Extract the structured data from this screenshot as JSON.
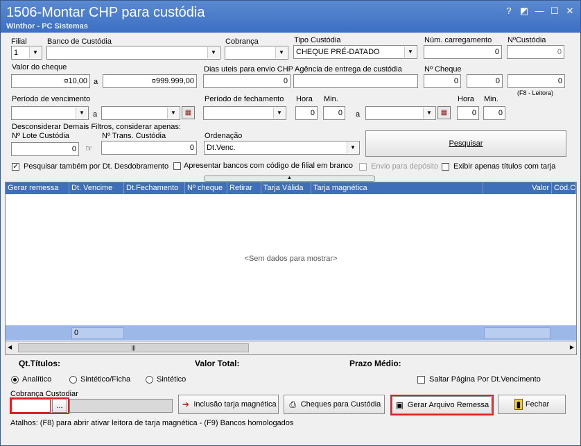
{
  "window": {
    "title": "1506-Montar CHP para custódia",
    "subtitle": "Winthor - PC Sistemas",
    "controls": [
      "?",
      "◩",
      "—",
      "☐",
      "✕"
    ]
  },
  "filters": {
    "filial": {
      "label": "Filial",
      "value": "1"
    },
    "banco_custodia": {
      "label": "Banco de Custódia",
      "value": ""
    },
    "cobranca": {
      "label": "Cobrança",
      "value": ""
    },
    "tipo_custodia": {
      "label": "Tipo Custódia",
      "value": "CHEQUE PRÉ-DATADO"
    },
    "num_carregamento": {
      "label": "Núm. carregamento",
      "value": "0"
    },
    "num_custodia": {
      "label": "NºCustódia",
      "value": "0"
    },
    "valor_cheque": {
      "label": "Valor do cheque",
      "from": "¤10,00",
      "sep": "a",
      "to": "¤999.999,00"
    },
    "dias_uteis": {
      "label": "Dias uteis para envio CHP",
      "value": "0"
    },
    "agencia_entrega": {
      "label": "Agência de entrega de custódia",
      "value": ""
    },
    "num_cheque": {
      "label": "Nº Cheque",
      "value1": "0",
      "value2": "0",
      "value3": "0",
      "hint": "(F8 - Leitora)"
    },
    "periodo_vencimento": {
      "label": "Período de vencimento",
      "sep": "a"
    },
    "periodo_fechamento": {
      "label": "Período de fechamento",
      "sep": "a"
    },
    "hora1": {
      "label": "Hora",
      "value": "0"
    },
    "min1": {
      "label": "Min.",
      "value": "0"
    },
    "hora2": {
      "label": "Hora",
      "value": "0"
    },
    "min2": {
      "label": "Min.",
      "value": "0"
    },
    "desconsiderar": "Desconsiderar Demais Filtros, considerar apenas:",
    "lote_custodia": {
      "label": "Nº Lote Custódia",
      "value": "0"
    },
    "trans_custodia": {
      "label": "Nº Trans. Custódia",
      "value": "0"
    },
    "ordenacao": {
      "label": "Ordenação",
      "value": "Dt.Venc."
    },
    "pesquisar_label": "Pesquisar",
    "chk_desdobramento": {
      "label": "Pesquisar também por Dt. Desdobramento",
      "checked": true
    },
    "chk_bancos_filial": {
      "label": "Apresentar bancos com código de filial em branco",
      "checked": false
    },
    "chk_envio_deposito": {
      "label": "Envio para depósito",
      "checked": false
    },
    "chk_tarja": {
      "label": "Exibir apenas títulos com tarja",
      "checked": false
    }
  },
  "grid": {
    "columns": [
      "Gerar remessa",
      "Dt. Vencime",
      "Dt.Fechamento",
      "Nº cheque",
      "Retirar",
      "Tarja Válida",
      "Tarja magnética",
      "Valor",
      "Cód.C"
    ],
    "empty_text": "<Sem dados para mostrar>",
    "footer_count": "0"
  },
  "summary": {
    "qt_titulos": "Qt.Títulos:",
    "valor_total": "Valor Total:",
    "prazo_medio": "Prazo Médio:"
  },
  "report_type": {
    "options": [
      "Analítico",
      "Sintético/Ficha",
      "Sintético"
    ],
    "selected": "Analítico",
    "saltar_pagina": "Saltar Página Por Dt.Vencimento"
  },
  "cobranca_custodiar": {
    "label": "Cobrança Custodiar",
    "value": "",
    "button": "..."
  },
  "buttons": {
    "inclusao_tarja": "Inclusão tarja magnética",
    "cheques_custodia": "Cheques para Custódia",
    "gerar_arquivo": "Gerar Arquivo Remessa",
    "fechar": "Fechar"
  },
  "shortcuts": "Atalhos: (F8) para abrir ativar leitora de tarja magnética - (F9) Bancos homologados",
  "colors": {
    "titlebar": "#3b6fc4",
    "grid_header": "#3f6fb8",
    "highlight": "#e02020"
  }
}
